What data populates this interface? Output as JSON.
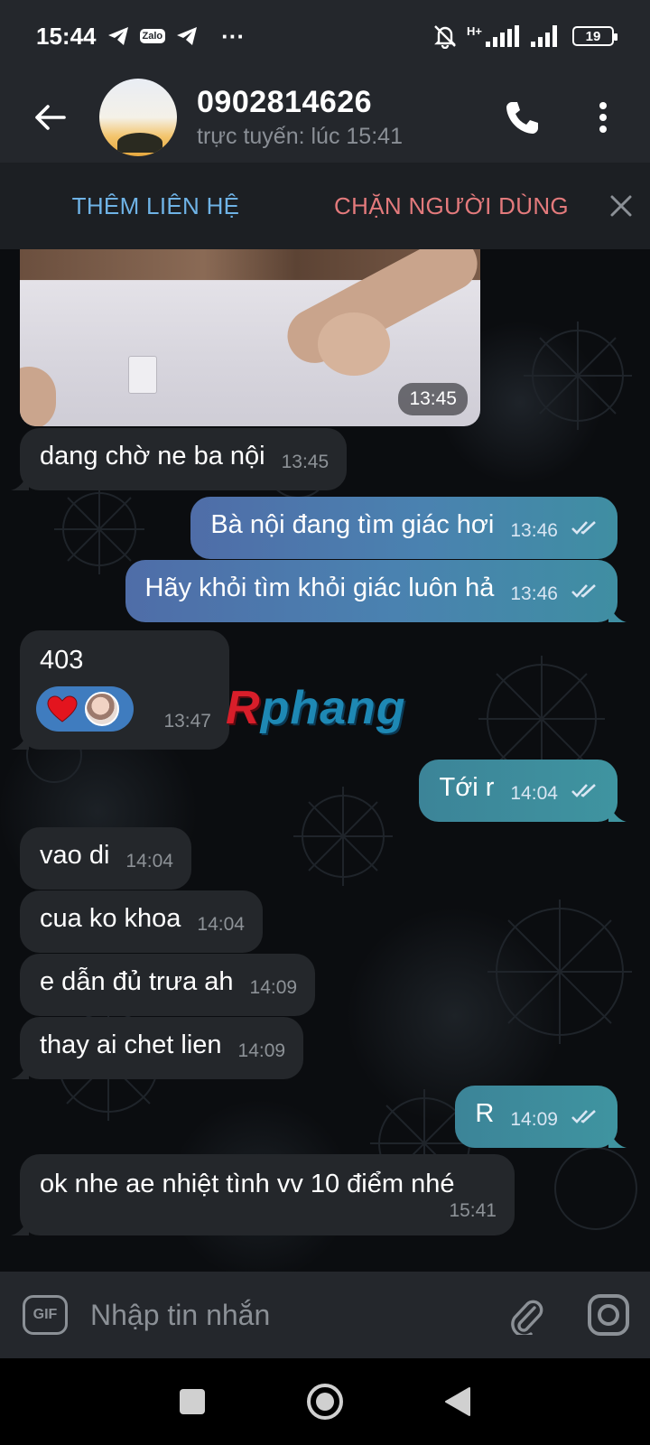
{
  "status_bar": {
    "time": "15:44",
    "zalo_label": "Zalo",
    "more": "···",
    "network": "H+",
    "battery": "19"
  },
  "header": {
    "contact_name": "0902814626",
    "contact_status": "trực tuyến: lúc 15:41"
  },
  "action_bar": {
    "add_contact": "THÊM LIÊN HỆ",
    "block_user": "CHẶN NGƯỜI DÙNG"
  },
  "messages": {
    "photo_time": "13:45",
    "m1": {
      "text": "dang chờ ne ba nội",
      "time": "13:45"
    },
    "m2": {
      "text": "Bà nội đang tìm giác hơi",
      "time": "13:46"
    },
    "m3": {
      "text": "Hãy khỏi tìm khỏi giác luôn hả",
      "time": "13:46"
    },
    "m4": {
      "text": "403",
      "time": "13:47"
    },
    "m5": {
      "text": "Tới r",
      "time": "14:04"
    },
    "m6": {
      "text": "vao di",
      "time": "14:04"
    },
    "m7": {
      "text": "cua ko khoa",
      "time": "14:04"
    },
    "m8": {
      "text": "e dẫn đủ trưa ah",
      "time": "14:09"
    },
    "m9": {
      "text": "thay ai chet lien",
      "time": "14:09"
    },
    "m10": {
      "text": "R",
      "time": "14:09"
    },
    "m11": {
      "text": "ok nhe ae nhiệt tình vv 10 điểm nhé",
      "time": "15:41"
    }
  },
  "watermark": {
    "first": "R",
    "rest": "phang"
  },
  "input": {
    "placeholder": "Nhập tin nhắn",
    "gif": "GIF"
  },
  "icons": [
    "back-arrow",
    "phone",
    "more-vertical",
    "close",
    "heart",
    "double-check",
    "gif",
    "attachment",
    "camera",
    "nav-square",
    "nav-circle",
    "nav-back-triangle"
  ],
  "colors": {
    "outgoing": "#4a82b0",
    "incoming": "#24272b",
    "add_contact": "#6fb3e6",
    "block_user": "#e37a7c"
  }
}
